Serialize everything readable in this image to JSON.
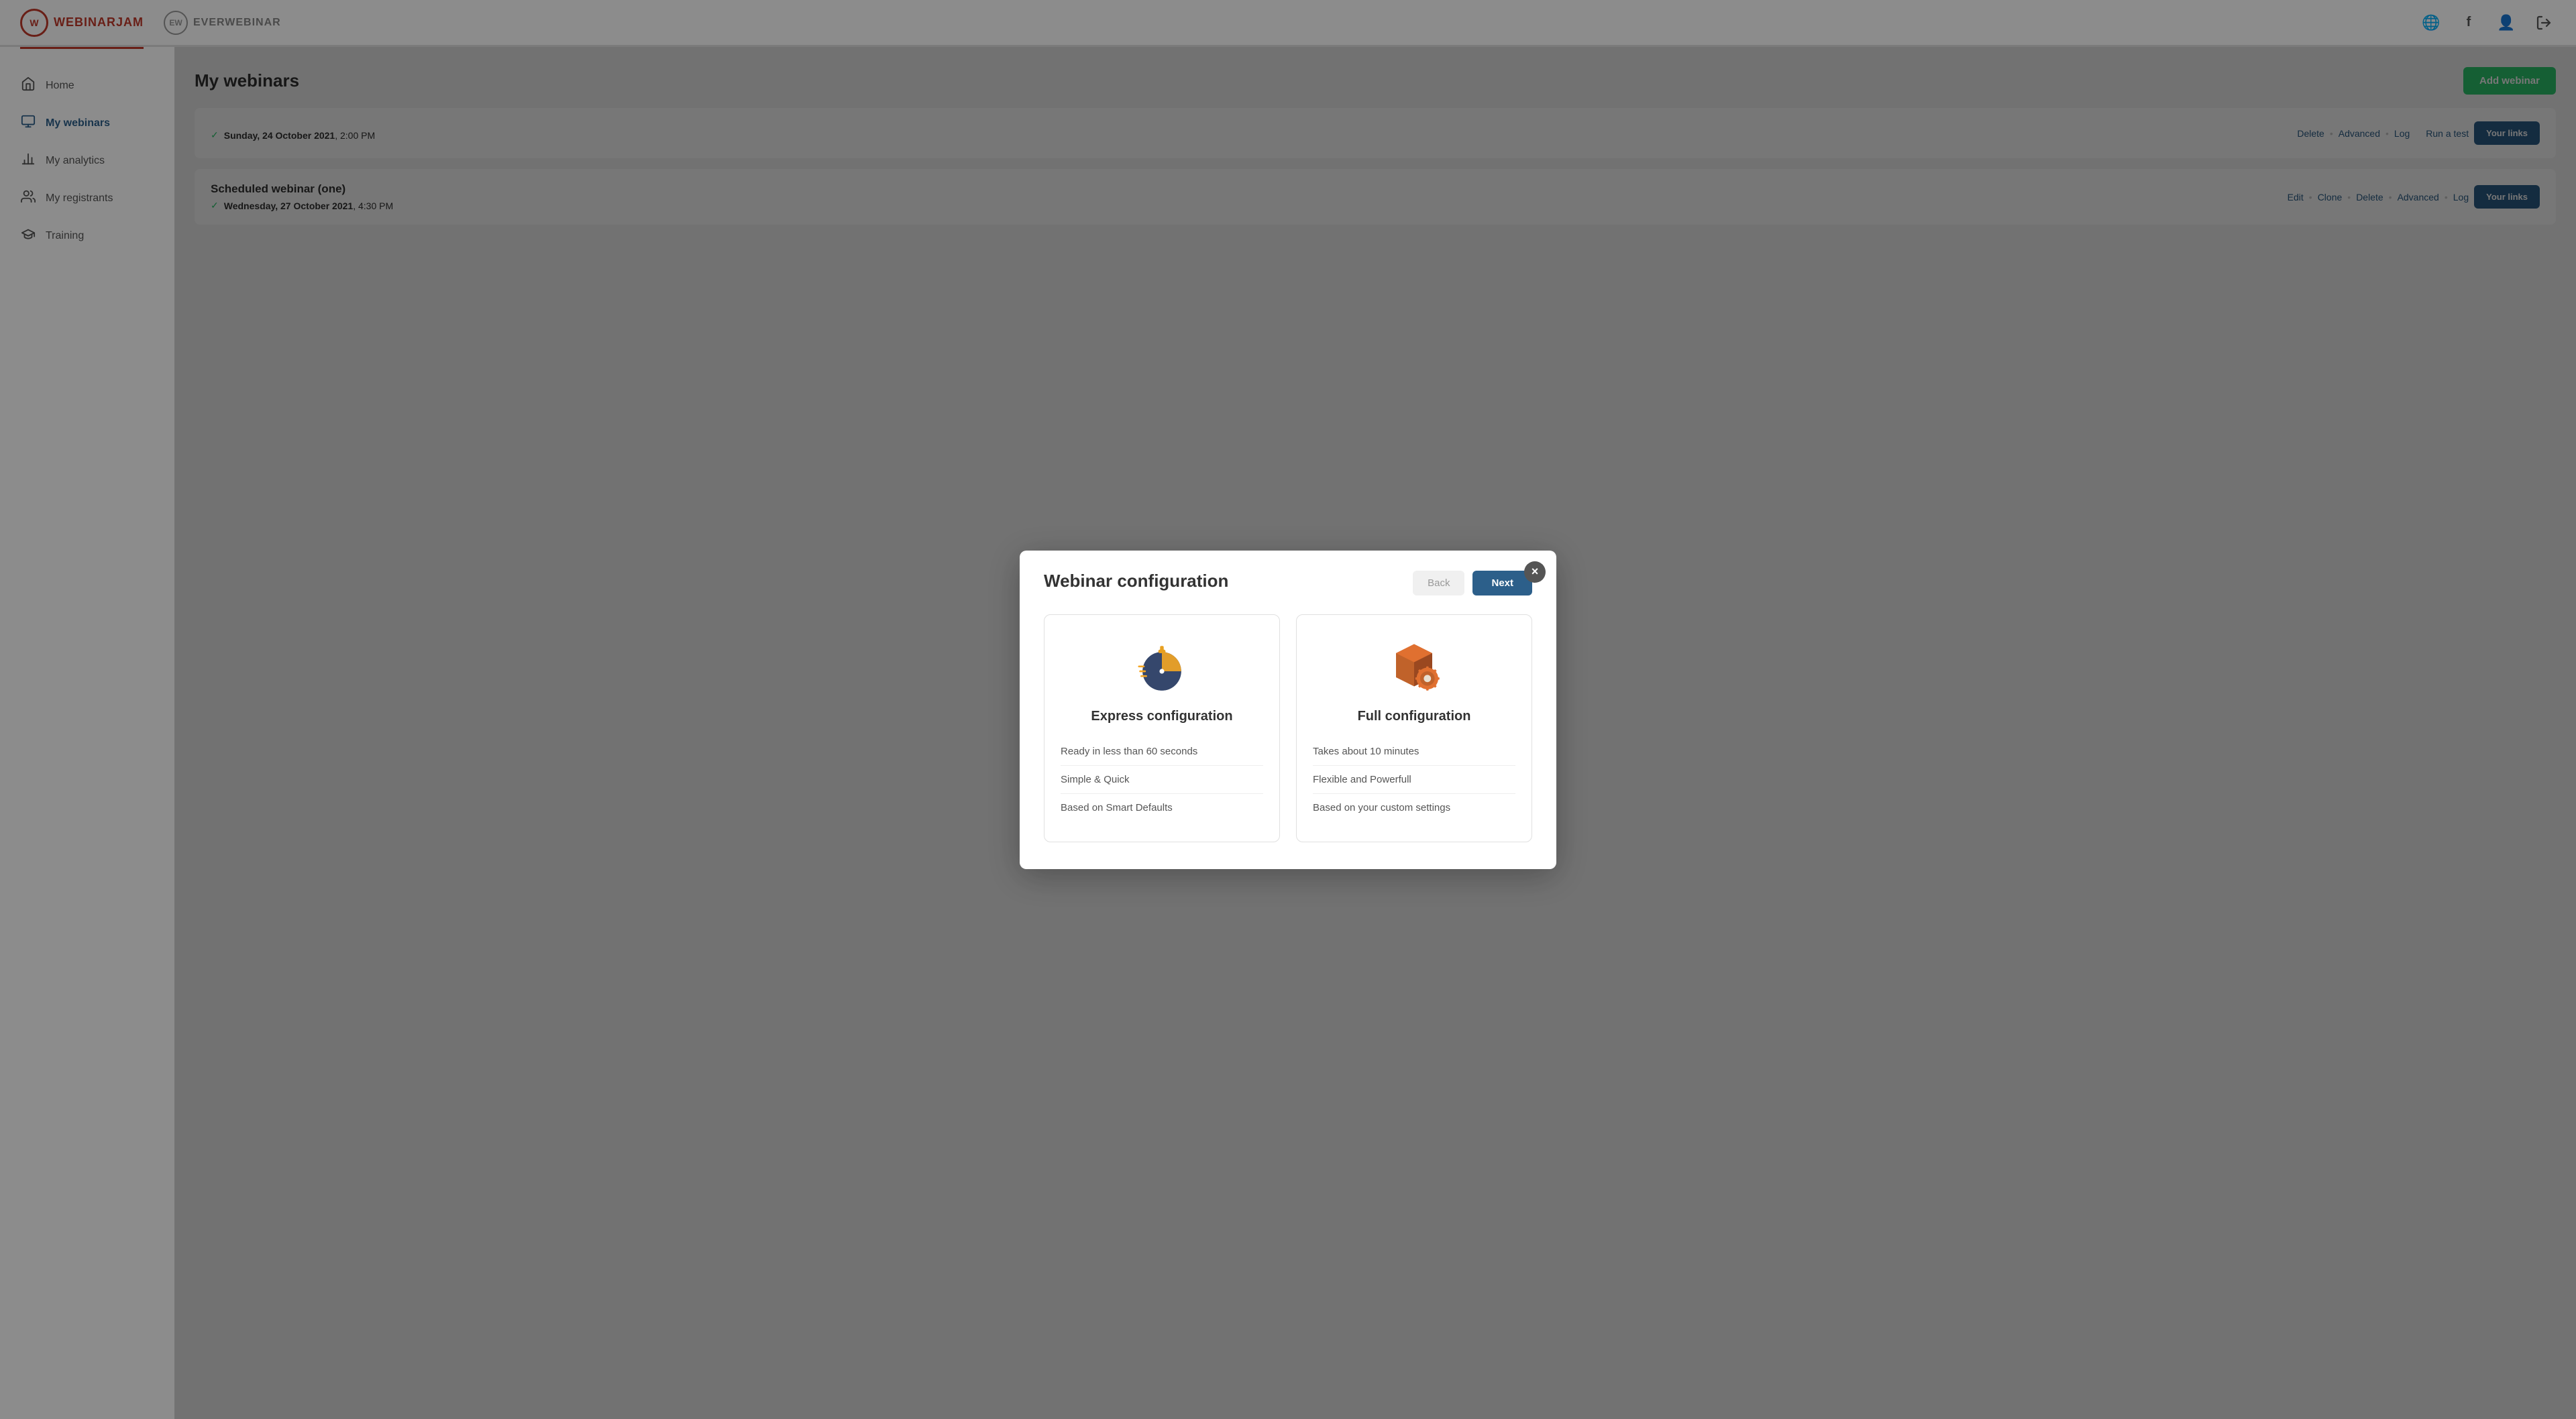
{
  "header": {
    "logo_wj_initials": "W",
    "logo_wj_text": "WEBINARJAM",
    "logo_ew_initials": "EW",
    "logo_ew_text": "EVERWEBINAR",
    "globe_icon": "🌐",
    "facebook_icon": "f",
    "user_icon": "👤",
    "logout_icon": "⏻"
  },
  "sidebar": {
    "items": [
      {
        "id": "home",
        "label": "Home",
        "icon": "🏠"
      },
      {
        "id": "my-webinars",
        "label": "My webinars",
        "icon": "📋",
        "active": true
      },
      {
        "id": "my-analytics",
        "label": "My analytics",
        "icon": "📈"
      },
      {
        "id": "my-registrants",
        "label": "My registrants",
        "icon": "👥"
      },
      {
        "id": "training",
        "label": "Training",
        "icon": "🎓"
      }
    ]
  },
  "main": {
    "page_title": "My webinars",
    "add_webinar_label": "Add webinar",
    "webinars": [
      {
        "id": 1,
        "label": "",
        "actions": [
          "Delete",
          "Advanced",
          "Log"
        ],
        "run_test": "Run a test",
        "your_links": "Your links",
        "date": "Sunday, 24 October 2021",
        "time": "2:00 PM"
      },
      {
        "id": 2,
        "label": "Scheduled webinar (one)",
        "actions": [
          "Edit",
          "Clone",
          "Delete",
          "Advanced",
          "Log"
        ],
        "run_test": "",
        "your_links": "Your links",
        "date": "Wednesday, 27 October 2021",
        "time": "4:30 PM"
      }
    ]
  },
  "modal": {
    "title": "Webinar configuration",
    "back_label": "Back",
    "next_label": "Next",
    "close_label": "×",
    "express": {
      "title": "Express configuration",
      "features": [
        "Ready in less than 60 seconds",
        "Simple & Quick",
        "Based on Smart Defaults"
      ]
    },
    "full": {
      "title": "Full configuration",
      "features": [
        "Takes about 10 minutes",
        "Flexible and Powerfull",
        "Based on your custom settings"
      ]
    }
  }
}
